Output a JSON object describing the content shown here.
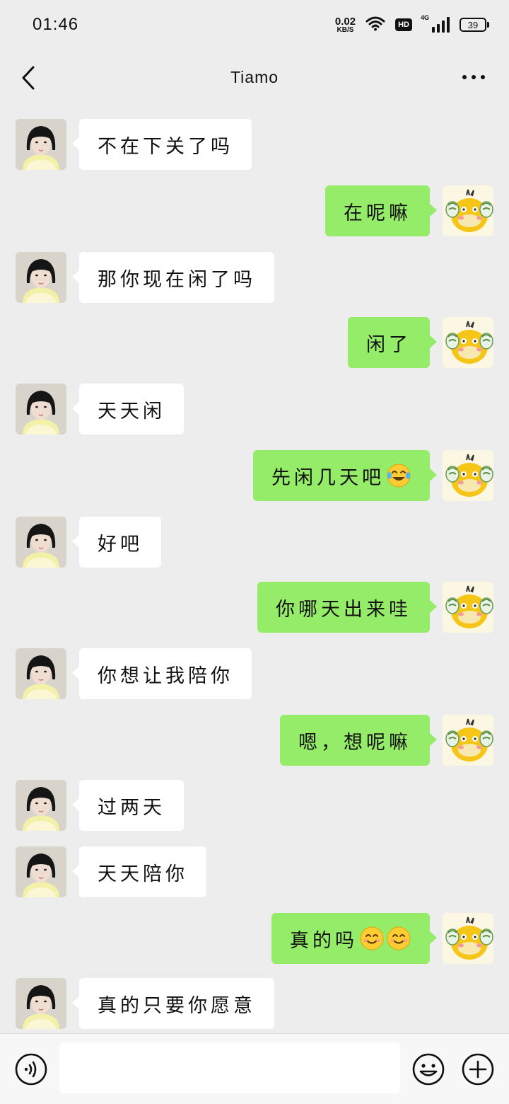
{
  "status_bar": {
    "time": "01:46",
    "net_speed_value": "0.02",
    "net_speed_unit": "KB/S",
    "hd_label": "HD",
    "network_label": "4G",
    "battery_level": "39",
    "icons": [
      "wifi-icon",
      "hd-icon",
      "signal-icon",
      "battery-icon"
    ]
  },
  "header": {
    "title": "Tiamo",
    "back_icon": "chevron-left-icon",
    "more_icon": "more-icon"
  },
  "contact_avatar": "contact-avatar-photo",
  "self_avatar": "yellow-duck-avatar",
  "messages": [
    {
      "side": "left",
      "text": "不在下关了吗"
    },
    {
      "side": "right",
      "text": "在呢嘛"
    },
    {
      "side": "left",
      "text": "那你现在闲了吗"
    },
    {
      "side": "right",
      "text": "闲了"
    },
    {
      "side": "left",
      "text": "天天闲"
    },
    {
      "side": "right",
      "text": "先闲几天吧",
      "emoji": [
        "laughing-tears-emoji"
      ]
    },
    {
      "side": "left",
      "text": "好吧"
    },
    {
      "side": "right",
      "text": "你哪天出来哇"
    },
    {
      "side": "left",
      "text": "你想让我陪你"
    },
    {
      "side": "right",
      "text": "嗯，想呢嘛"
    },
    {
      "side": "left",
      "text": "过两天"
    },
    {
      "side": "left",
      "text": "天天陪你"
    },
    {
      "side": "right",
      "text": "真的吗",
      "emoji": [
        "smiling-face-emoji",
        "smiling-face-emoji"
      ]
    },
    {
      "side": "left",
      "text": "真的只要你愿意"
    }
  ],
  "input_bar": {
    "voice_icon": "voice-icon",
    "emoji_icon": "emoji-icon",
    "plus_icon": "plus-icon",
    "input_value": ""
  },
  "colors": {
    "background": "#ededed",
    "self_bubble": "#95ec69",
    "other_bubble": "#ffffff"
  }
}
